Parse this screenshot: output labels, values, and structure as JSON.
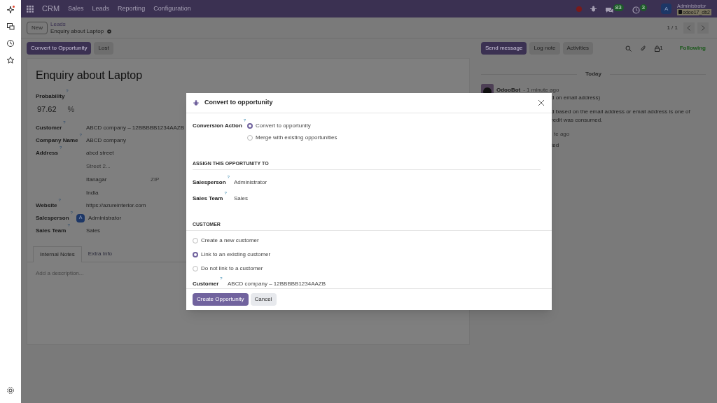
{
  "nav": {
    "app": "CRM",
    "menu": [
      "Sales",
      "Leads",
      "Reporting",
      "Configuration"
    ],
    "messages_count": "83",
    "activities_count": "3",
    "user_initial": "A",
    "user_name": "Administrator",
    "database": "odoo17_db2"
  },
  "breadcrumb": {
    "new_button": "New",
    "parent": "Leads",
    "current": "Enquiry about Laptop",
    "pager": "1 / 1"
  },
  "actions": [
    {
      "label": "Convert to Opportunity",
      "primary": true
    },
    {
      "label": "Lost",
      "primary": false
    }
  ],
  "form": {
    "title": "Enquiry about Laptop",
    "probability": {
      "label": "Probability",
      "help": "?",
      "value": "97.62",
      "unit": "%"
    },
    "fields": [
      {
        "label": "Customer",
        "help": "?",
        "kind": "text",
        "value": "ABCD company – 12BBBBB1234AAZB"
      },
      {
        "label": "Company Name",
        "help": "?",
        "kind": "text",
        "value": "ABCD company"
      },
      {
        "label": "Address",
        "help": "?",
        "kind": "address",
        "street": "abcd street",
        "street2_placeholder": "Street 2...",
        "city": "Itanagar",
        "zip_placeholder": "ZIP",
        "country": "India"
      },
      {
        "label": "Website",
        "help": "?",
        "kind": "text",
        "value": "https://azureinterior.com"
      },
      {
        "label": "Salesperson",
        "help": "?",
        "kind": "user",
        "initial": "A",
        "value": "Administrator"
      },
      {
        "label": "Sales Team",
        "help": "?",
        "kind": "text",
        "value": "Sales"
      }
    ],
    "tabs": [
      {
        "label": "Internal Notes",
        "selected": true
      },
      {
        "label": "Extra Info",
        "selected": false
      }
    ],
    "notes_placeholder": "Add a description..."
  },
  "chatter": {
    "buttons": [
      {
        "label": "Send message",
        "primary": true
      },
      {
        "label": "Log note",
        "primary": false
      },
      {
        "label": "Activities",
        "primary": false
      }
    ],
    "followers_count": "1",
    "follow_status": "Following",
    "date": "Today",
    "messages": [
      {
        "author": "OdooBot",
        "time": "- 1 minute ago",
        "lines": [
          "d on email address)",
          "d based on the email address or email address is one of",
          "redit was consumed."
        ]
      },
      {
        "time": "te ago",
        "lines": [
          "ted"
        ]
      }
    ]
  },
  "dialog": {
    "title": "Convert to opportunity",
    "conversion_action": {
      "label": "Conversion Action",
      "help": "?",
      "options": [
        {
          "label": "Convert to opportunity",
          "selected": true
        },
        {
          "label": "Merge with existing opportunities",
          "selected": false
        }
      ]
    },
    "assign_heading": "ASSIGN THIS OPPORTUNITY TO",
    "assign_fields": [
      {
        "label": "Salesperson",
        "help": "?",
        "value": "Administrator"
      },
      {
        "label": "Sales Team",
        "help": "?",
        "value": "Sales"
      }
    ],
    "customer_heading": "CUSTOMER",
    "customer_options": [
      {
        "label": "Create a new customer",
        "selected": false
      },
      {
        "label": "Link to an existing customer",
        "selected": true
      },
      {
        "label": "Do not link to a customer",
        "selected": false
      }
    ],
    "customer_field": {
      "label": "Customer",
      "help": "?",
      "value": "ABCD company – 12BBBBB1234AAZB"
    },
    "buttons": [
      {
        "label": "Create Opportunity",
        "primary": true
      },
      {
        "label": "Cancel",
        "primary": false
      }
    ]
  }
}
